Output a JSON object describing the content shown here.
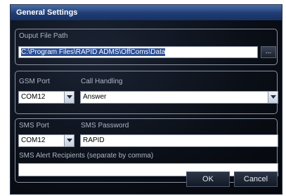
{
  "window": {
    "title": "General Settings"
  },
  "output": {
    "label": "Ouput File Path",
    "path": "C:\\Program Files\\RAPID ADMS\\OffComs\\Data",
    "browse_label": "..."
  },
  "gsm": {
    "port_label": "GSM Port",
    "port_value": "COM12",
    "handling_label": "Call Handling",
    "handling_value": "Answer"
  },
  "sms": {
    "port_label": "SMS Port",
    "port_value": "COM12",
    "password_label": "SMS Password",
    "password_value": "RAPID",
    "recipients_label": "SMS Alert Recipients (separate by comma)",
    "recipients_value": ""
  },
  "buttons": {
    "ok": "OK",
    "cancel": "Cancel"
  },
  "icons": {
    "dropdown": "chevron-down-icon"
  },
  "colors": {
    "title_bar": "#1f3c73",
    "selection": "#2a4f96",
    "background": "#0a0e16"
  }
}
